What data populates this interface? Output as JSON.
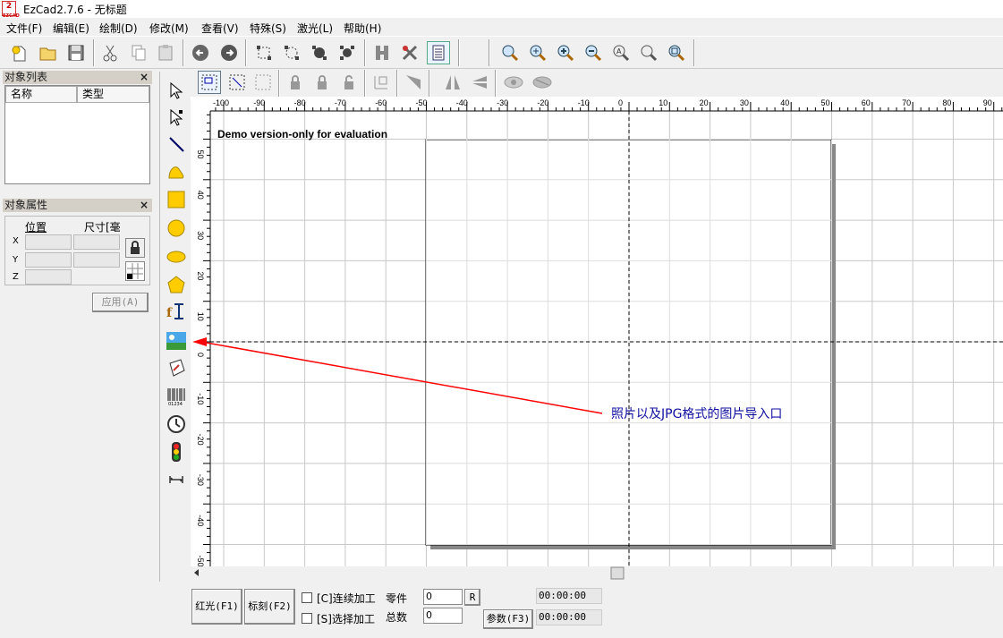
{
  "app": {
    "title": "EzCad2.7.6 - 无标题",
    "logo_text": "EZCAD"
  },
  "menu": [
    "文件(F)",
    "编辑(E)",
    "绘制(D)",
    "修改(M)",
    "查看(V)",
    "特殊(S)",
    "激光(L)",
    "帮助(H)"
  ],
  "toolbar_icons": [
    "new-icon",
    "open-icon",
    "save-icon",
    "cut-icon",
    "copy-icon",
    "paste-icon",
    "undo-icon",
    "redo-icon",
    "node-edit-icon",
    "node-select-icon",
    "node-move-icon",
    "node-align-icon",
    "hatch-icon",
    "settings-tool-icon",
    "parameters-icon",
    "zoom-icon",
    "zoom-in-icon",
    "zoom-plus-icon",
    "zoom-out-icon",
    "zoom-all-icon",
    "zoom-select-icon",
    "zoom-page-icon"
  ],
  "object_list": {
    "title": "对象列表",
    "close": "×",
    "col_name": "名称",
    "col_type": "类型"
  },
  "object_props": {
    "title": "对象属性",
    "close": "×",
    "col_pos": "位置",
    "col_size": "尺寸[毫",
    "axes": [
      "X",
      "Y",
      "Z"
    ],
    "apply_label": "应用(A)"
  },
  "draw_tools": [
    "select-arrow-icon",
    "node-tool-icon",
    "line-icon",
    "curve-icon",
    "rectangle-icon",
    "circle-icon",
    "ellipse-icon",
    "polygon-icon",
    "text-icon",
    "bitmap-import-icon",
    "vector-file-icon",
    "barcode-icon",
    "delay-clock-icon",
    "io-signal-icon",
    "port-output-icon"
  ],
  "canvas": {
    "watermark": "Demo version-only for evaluation",
    "annotation": "照片以及JPG格式的图片导入口",
    "h_ticks": [
      "-100",
      "-90",
      "-80",
      "-70",
      "-60",
      "-50",
      "-40",
      "-30",
      "-20",
      "-10",
      "0",
      "10",
      "20",
      "30",
      "40",
      "50",
      "60",
      "70",
      "80",
      "90"
    ],
    "v_ticks": [
      "50",
      "40",
      "30",
      "20",
      "10",
      "0",
      "-10",
      "-20",
      "-30",
      "-40",
      "-50"
    ],
    "colors": {
      "arrow": "#ff0000",
      "annotation": "#1010a0"
    }
  },
  "status": {
    "red_light": "红光(F1)",
    "mark": "标刻(F2)",
    "continuous": "[C]连续加工",
    "selected": "[S]选择加工",
    "parts_label": "零件",
    "parts_value": "0",
    "reset": "R",
    "total_label": "总数",
    "total_value": "0",
    "params": "参数(F3)",
    "time1": "00:00:00",
    "time2": "00:00:00"
  }
}
